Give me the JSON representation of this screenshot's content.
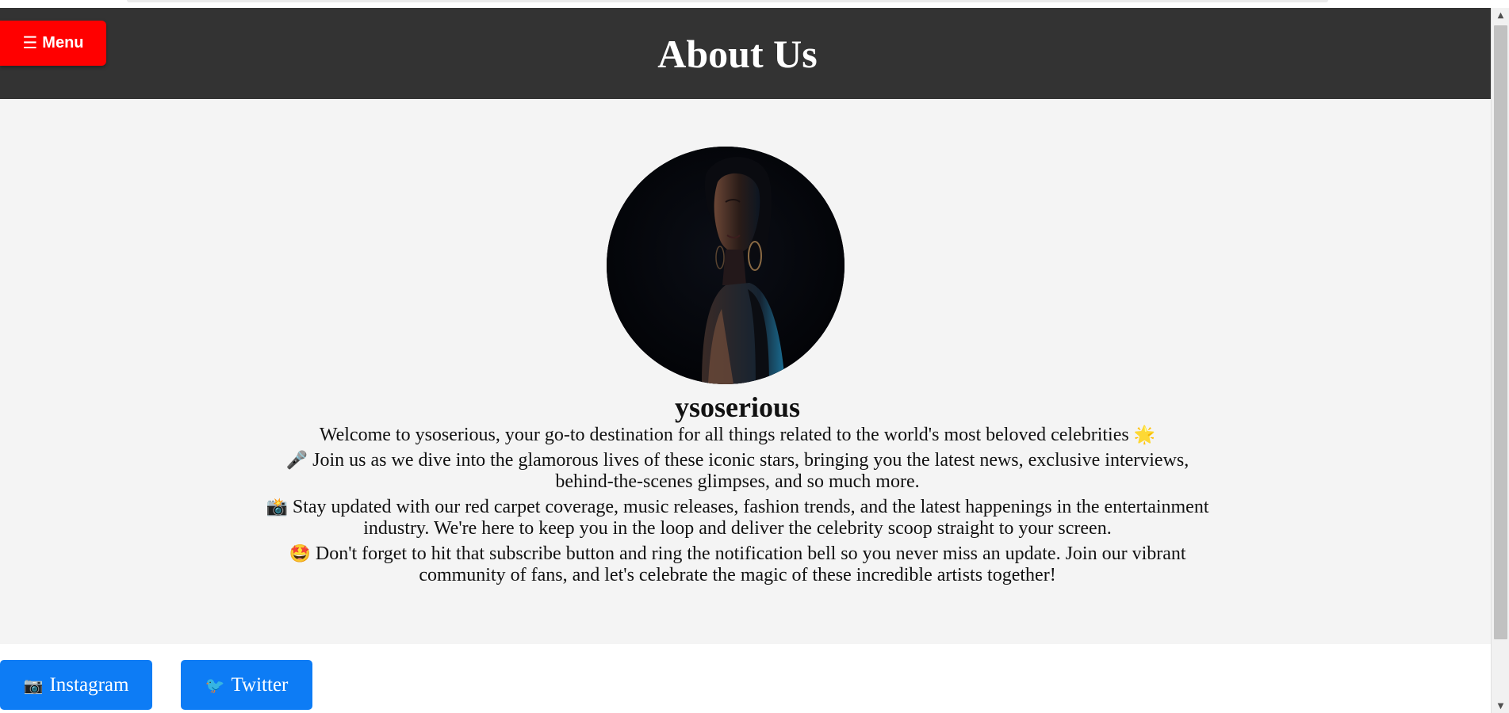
{
  "header": {
    "menu_icon": "☰",
    "menu_label": "Menu",
    "title": "About Us"
  },
  "profile": {
    "avatar_icon": "portrait-photo",
    "name": "ysoserious",
    "bio": [
      {
        "prefix": "",
        "text": "Welcome to ysoserious, your go-to destination for all things related to the world's most beloved celebrities",
        "suffix": "🌟"
      },
      {
        "prefix": "🎤",
        "text": "Join us as we dive into the glamorous lives of these iconic stars, bringing you the latest news, exclusive interviews, behind-the-scenes glimpses, and so much more.",
        "suffix": ""
      },
      {
        "prefix": "📸",
        "text": "Stay updated with our red carpet coverage, music releases, fashion trends, and the latest happenings in the entertainment industry. We're here to keep you in the loop and deliver the celebrity scoop straight to your screen.",
        "suffix": ""
      },
      {
        "prefix": "🤩",
        "text": "Don't forget to hit that subscribe button and ring the notification bell so you never miss an update. Join our vibrant community of fans, and let's celebrate the magic of these incredible artists together!",
        "suffix": ""
      }
    ]
  },
  "social": {
    "instagram": {
      "icon": "📷",
      "label": "Instagram"
    },
    "twitter": {
      "icon": "🐦",
      "label": "Twitter"
    }
  },
  "colors": {
    "header_bg": "#333333",
    "menu_button": "#ff0000",
    "section_bg": "#f4f4f4",
    "social_button": "#0d7cf5"
  },
  "scrollbar": {
    "up_icon": "▲",
    "down_icon": "▼"
  }
}
